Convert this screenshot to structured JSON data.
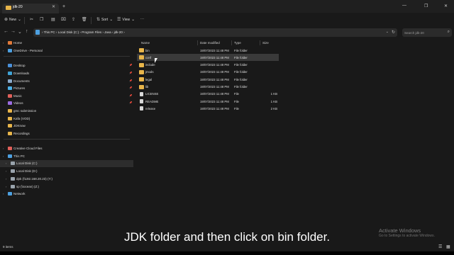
{
  "window": {
    "tab_title": "jdk-20",
    "new_tab": "+",
    "minimize": "—",
    "maximize": "❐",
    "close": "✕"
  },
  "toolbar": {
    "new_label": "New",
    "sort_label": "Sort",
    "view_label": "View",
    "more": "···"
  },
  "address": {
    "crumbs": "›  This PC  ›  Local Disk (C:)  ›  Program Files  ›  Java  ›  jdk-20  ›",
    "search_placeholder": "Search jdk-20"
  },
  "sidebar": {
    "items": [
      {
        "label": "Home",
        "color": "#e07a3a"
      },
      {
        "label": "OneDrive - Personal",
        "color": "#4da0e0"
      },
      {
        "label": "Desktop",
        "color": "#4a90d9",
        "pinned": true
      },
      {
        "label": "Downloads",
        "color": "#3fa3d6",
        "pinned": true
      },
      {
        "label": "Documents",
        "color": "#8aa9c9",
        "pinned": true
      },
      {
        "label": "Pictures",
        "color": "#4db1e8",
        "pinned": true
      },
      {
        "label": "Music",
        "color": "#e0605a",
        "pinned": true
      },
      {
        "label": "Videos",
        "color": "#9b6ce0",
        "pinned": true
      },
      {
        "label": "gmc submission",
        "color": "#e8b54a"
      },
      {
        "label": "Kafa (VOD)",
        "color": "#e8b54a"
      },
      {
        "label": "JDKnow",
        "color": "#e8b54a"
      },
      {
        "label": "Recordings",
        "color": "#e8b54a"
      },
      {
        "label": "Creative Cloud Files",
        "color": "#e0605a"
      },
      {
        "label": "This PC",
        "color": "#4da0e0"
      },
      {
        "label": "Local Disk (C:)",
        "color": "#9aa4ad"
      },
      {
        "label": "Local Disk (D:)",
        "color": "#9aa4ad"
      },
      {
        "label": "dpk (\\\\192.168.20.23) (Y:)",
        "color": "#9aa4ad"
      },
      {
        "label": "sp (\\\\ocean) (Z:)",
        "color": "#9aa4ad"
      },
      {
        "label": "Network",
        "color": "#4da0e0"
      }
    ]
  },
  "columns": {
    "name": "Name",
    "date": "Date modified",
    "type": "Type",
    "size": "Size"
  },
  "files": [
    {
      "name": "bin",
      "date": "19/07/2023 11:48 PM",
      "type": "File folder",
      "size": "",
      "kind": "folder"
    },
    {
      "name": "conf",
      "date": "19/07/2023 11:48 PM",
      "type": "File folder",
      "size": "",
      "kind": "folder"
    },
    {
      "name": "include",
      "date": "19/07/2023 11:48 PM",
      "type": "File folder",
      "size": "",
      "kind": "folder"
    },
    {
      "name": "jmods",
      "date": "19/07/2023 11:48 PM",
      "type": "File folder",
      "size": "",
      "kind": "folder"
    },
    {
      "name": "legal",
      "date": "19/07/2023 11:48 PM",
      "type": "File folder",
      "size": "",
      "kind": "folder"
    },
    {
      "name": "lib",
      "date": "19/07/2023 11:48 PM",
      "type": "File folder",
      "size": "",
      "kind": "folder"
    },
    {
      "name": "LICENSE",
      "date": "19/07/2023 11:48 PM",
      "type": "File",
      "size": "1 KB",
      "kind": "file"
    },
    {
      "name": "README",
      "date": "19/07/2023 11:48 PM",
      "type": "File",
      "size": "1 KB",
      "kind": "file"
    },
    {
      "name": "release",
      "date": "19/07/2023 11:48 PM",
      "type": "File",
      "size": "2 KB",
      "kind": "file"
    }
  ],
  "status": {
    "items": "9 items"
  },
  "caption": "JDK folder and then click on bin folder.",
  "watermark": {
    "title": "Activate Windows",
    "subtitle": "Go to Settings to activate Windows."
  }
}
